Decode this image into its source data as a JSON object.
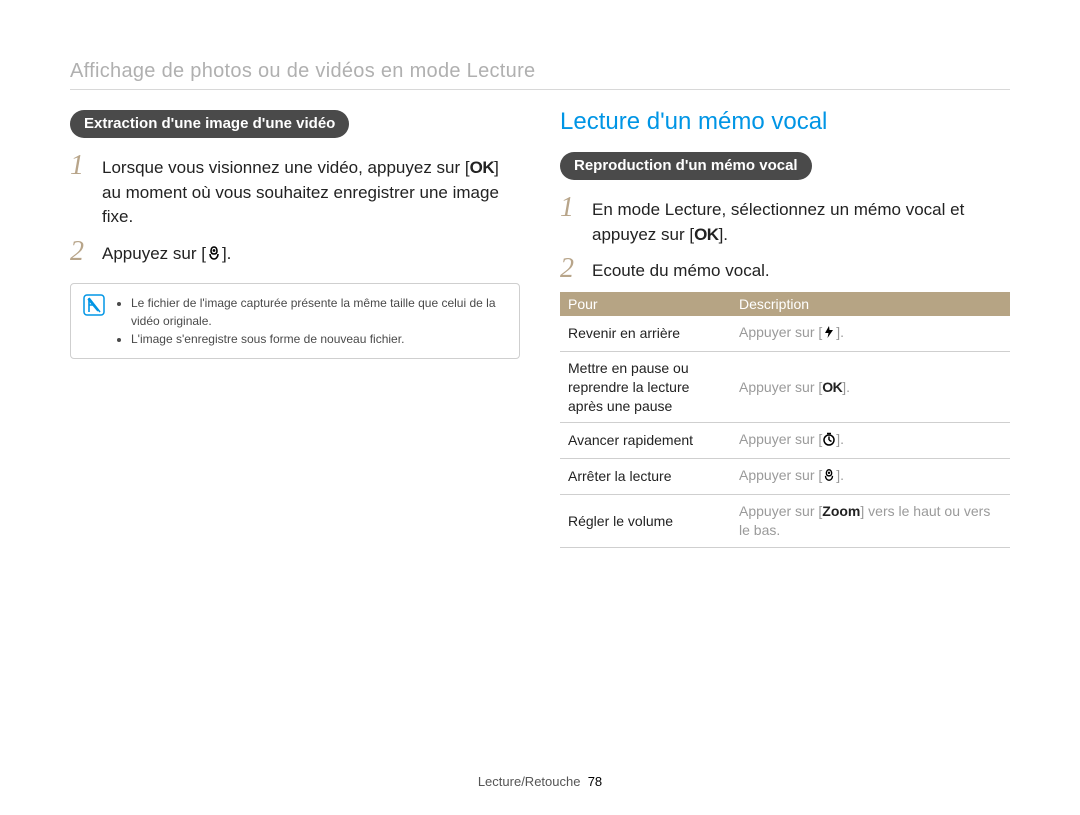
{
  "page_topic": "Affichage de photos ou de vidéos en mode Lecture",
  "left": {
    "pill": "Extraction d'une image d'une vidéo",
    "step1": {
      "num": "1",
      "before": "Lorsque vous visionnez une vidéo, appuyez sur [",
      "btn": "OK",
      "after": "] au moment où vous souhaitez enregistrer une image fixe."
    },
    "step2": {
      "num": "2",
      "before": "Appuyez sur [",
      "icon": "macro-icon",
      "after": "]."
    },
    "note": {
      "bullet1": "Le fichier de l'image capturée présente la même taille que celui de la vidéo originale.",
      "bullet2": "L'image s'enregistre sous forme de nouveau fichier."
    }
  },
  "right": {
    "title": "Lecture d'un mémo vocal",
    "pill": "Reproduction d'un mémo vocal",
    "step1": {
      "num": "1",
      "before": "En mode Lecture, sélectionnez un mémo vocal et appuyez sur [",
      "btn": "OK",
      "after": "]."
    },
    "step2": {
      "num": "2",
      "text": "Ecoute du mémo vocal."
    },
    "table": {
      "head_pour": "Pour",
      "head_desc": "Description",
      "rows": [
        {
          "pour": "Revenir en arrière",
          "desc_before": "Appuyer sur [",
          "icon": "flash-icon",
          "desc_after": "]."
        },
        {
          "pour": "Mettre en pause ou reprendre la lecture après une pause",
          "desc_before": "Appuyer sur [",
          "btn": "OK",
          "desc_after": "]."
        },
        {
          "pour": "Avancer rapidement",
          "desc_before": "Appuyer sur [",
          "icon": "timer-icon",
          "desc_after": "]."
        },
        {
          "pour": "Arrêter la lecture",
          "desc_before": "Appuyer sur [",
          "icon": "macro-icon",
          "desc_after": "]."
        },
        {
          "pour": "Régler le volume",
          "desc_before": "Appuyer sur [",
          "btn": "Zoom",
          "desc_mid": "] ",
          "grey": "vers le haut ou vers le bas."
        }
      ]
    }
  },
  "footer": {
    "section": "Lecture/Retouche",
    "page": "78"
  }
}
